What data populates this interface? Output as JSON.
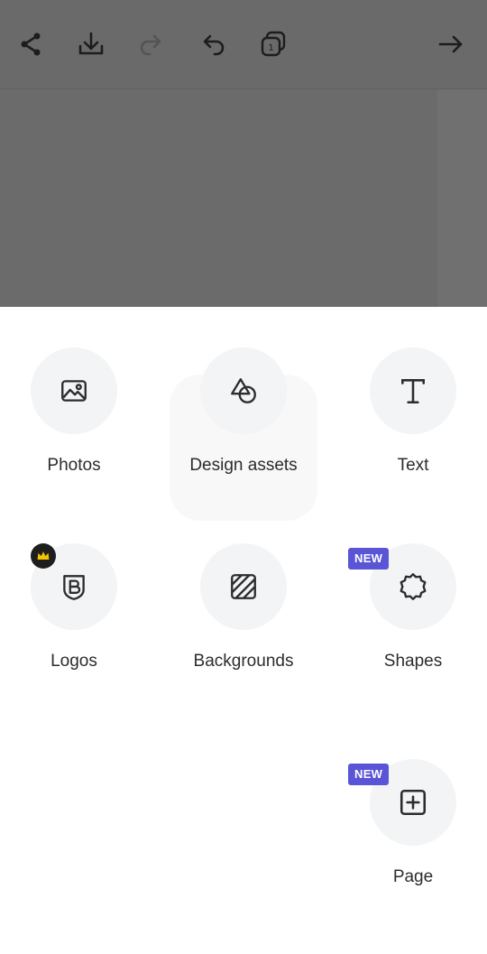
{
  "toolbar": {
    "icons": [
      "share-icon",
      "download-icon",
      "redo-icon",
      "undo-icon",
      "pages-icon",
      "arrow-right-icon"
    ],
    "page_count": "1"
  },
  "menu": {
    "items": [
      {
        "label": "Photos",
        "icon": "image-icon"
      },
      {
        "label": "Design assets",
        "icon": "shapes-blob-icon"
      },
      {
        "label": "Text",
        "icon": "text-icon"
      },
      {
        "label": "Logos",
        "icon": "logo-badge-icon",
        "premium": true
      },
      {
        "label": "Backgrounds",
        "icon": "stripes-icon"
      },
      {
        "label": "Shapes",
        "icon": "gear-shape-icon",
        "badge": "NEW"
      },
      {
        "label": "Page",
        "icon": "add-page-icon",
        "badge": "NEW"
      }
    ]
  },
  "colors": {
    "overlay": "#6b6b6b",
    "tile_bg": "#f3f4f6",
    "new_badge": "#5a55d6",
    "premium_badge": "#1e1e1e",
    "crown": "#f4c400"
  }
}
